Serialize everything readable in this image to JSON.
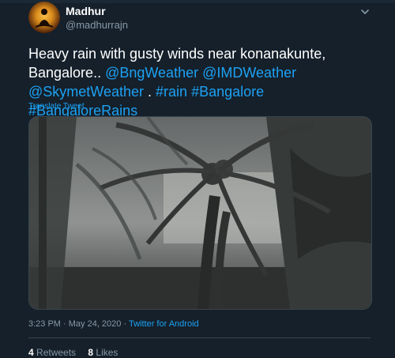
{
  "user": {
    "name": "Madhur",
    "handle": "@madhurrajn"
  },
  "tweet": {
    "text_plain_1": "Heavy rain with gusty winds near konanakunte, Bangalore.. ",
    "mention_1": "@BngWeather",
    "sep_1": " ",
    "mention_2": "@IMDWeather",
    "sep_2": " ",
    "mention_3": "@SkymetWeather",
    "sep_3": " . ",
    "hashtag_1": "#rain",
    "sep_4": " ",
    "hashtag_2": "#Bangalore",
    "sep_5": " ",
    "hashtag_3": "#BangaloreRains",
    "translate": "Translate Tweet"
  },
  "meta": {
    "time_date": "3:23 PM · May 24, 2020 · ",
    "source": "Twitter for Android"
  },
  "stats": {
    "retweets_count": "4",
    "retweets_label": " Retweets",
    "likes_count": "8",
    "likes_label": " Likes"
  },
  "colors": {
    "background": "#15202b",
    "link": "#1da1f2",
    "muted": "#8899a6",
    "border": "#38444d"
  },
  "icons": {
    "more": "chevron-down-icon"
  }
}
